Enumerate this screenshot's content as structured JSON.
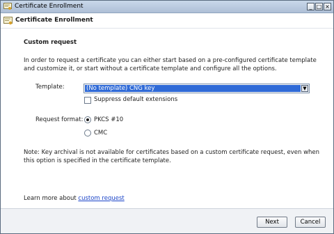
{
  "window": {
    "title": "Certificate Enrollment",
    "controls": {
      "minimize": "_",
      "maximize": "□",
      "close": "×"
    }
  },
  "header": {
    "title": "Certificate Enrollment",
    "icon": "certificate-icon"
  },
  "page": {
    "section_title": "Custom request",
    "description": "In order to request a certificate you can either start based on a pre-configured certificate template and customize it, or start without a certificate template and configure all the options.",
    "template": {
      "label": "Template:",
      "value": "(No template) CNG key",
      "arrow": "▼"
    },
    "suppress_default_extensions": {
      "label": "Suppress default extensions",
      "checked": false
    },
    "request_format": {
      "label": "Request format:",
      "options": [
        {
          "label": "PKCS #10",
          "selected": true
        },
        {
          "label": "CMC",
          "selected": false
        }
      ]
    },
    "note": "Note: Key archival is not available for certificates based on a custom certificate request, even when this option is specified in the certificate template.",
    "learn_more": {
      "prefix": "Learn more about ",
      "link": "custom request"
    }
  },
  "footer": {
    "next_label": "Next",
    "cancel_label": "Cancel"
  },
  "colors": {
    "accent_selection": "#2f6ad7",
    "link": "#1a44c8"
  }
}
